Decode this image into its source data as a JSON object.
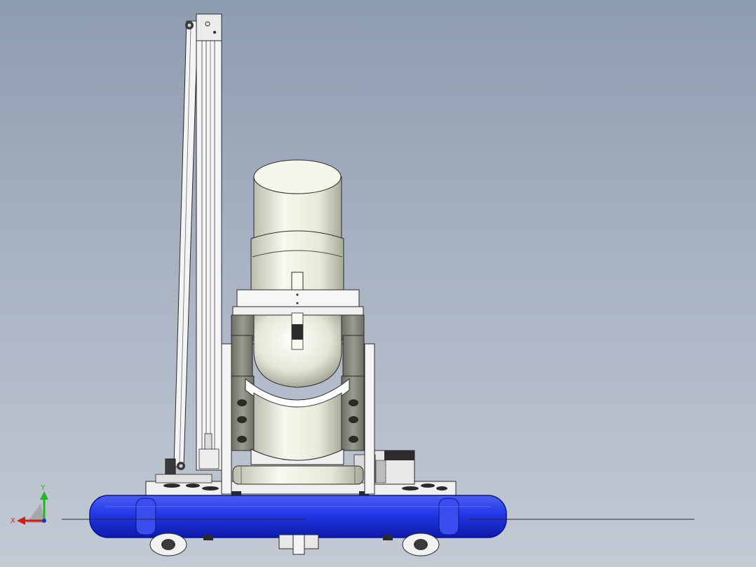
{
  "viewport": {
    "background_top": "#8e9cb0",
    "background_bottom": "#c3cad4"
  },
  "axis_triad": {
    "y_label": "Y",
    "x_label": "X",
    "y_color": "#1fb81f",
    "x_color": "#d81c1c",
    "z_color": "#1c2fd8"
  },
  "colors": {
    "float_body": "#2a3fe0",
    "float_shadow": "#0b1aa0",
    "cylinder": "#ececdc",
    "frame": "#f4f4f4",
    "clamp": "#8a8a80",
    "outline": "#2a2a2a"
  },
  "icons": [
    "coordinate-triad-icon"
  ]
}
